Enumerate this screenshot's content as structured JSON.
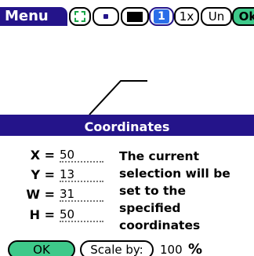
{
  "toolbar": {
    "menu_label": "Menu",
    "buttons": [
      {
        "name": "selection-tool",
        "icon": "selection-box-icon"
      },
      {
        "name": "pen-size",
        "icon": "dot-icon"
      },
      {
        "name": "fill-color",
        "icon": "fill-color-icon"
      },
      {
        "name": "layer",
        "label": "1"
      },
      {
        "name": "zoom",
        "label": "1x"
      },
      {
        "name": "undo",
        "label": "Un"
      },
      {
        "name": "ok",
        "label": "Ok"
      }
    ],
    "colors": {
      "bar": "#24148a",
      "ok": "#3ec98a",
      "layer": "#2a6ee8",
      "selection": "#1aa64a"
    }
  },
  "dialog": {
    "title": "Coordinates",
    "fields": [
      {
        "label": "X =",
        "value": "50"
      },
      {
        "label": "Y =",
        "value": "13"
      },
      {
        "label": "W =",
        "value": "31"
      },
      {
        "label": "H =",
        "value": "50"
      }
    ],
    "message_lines": [
      "The current",
      "selection will be",
      "set to the",
      "specified",
      "coordinates"
    ],
    "ok_label": "OK",
    "scale_label": "Scale by:",
    "scale_value": "100",
    "scale_unit": "%"
  }
}
